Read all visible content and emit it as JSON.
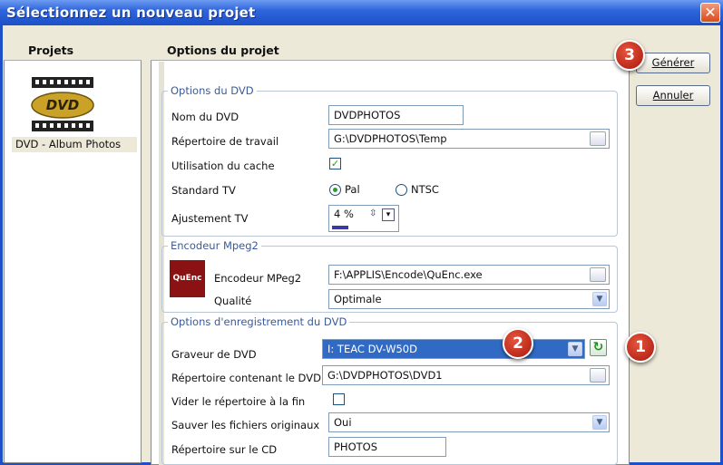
{
  "window": {
    "title": "Sélectionnez un nouveau projet",
    "close_glyph": "✕"
  },
  "projects": {
    "header": "Projets",
    "items": [
      {
        "label": "DVD - Album Photos",
        "icon": "dvd-video-icon"
      }
    ]
  },
  "options": {
    "header": "Options du projet"
  },
  "dvd_group": {
    "title": "Options du DVD",
    "name_label": "Nom du DVD",
    "name_value": "DVDPHOTOS",
    "workdir_label": "Répertoire de travail",
    "workdir_value": "G:\\DVDPHOTOS\\Temp",
    "cache_label": "Utilisation du cache",
    "cache_checked": "✓",
    "tv_label": "Standard TV",
    "tv_pal": "Pal",
    "tv_ntsc": "NTSC",
    "adjust_label": "Ajustement TV",
    "adjust_value": "4 %",
    "adjust_level": 0.25
  },
  "mpeg_group": {
    "title": "Encodeur Mpeg2",
    "logo_text": "QuEnc",
    "encoder_label": "Encodeur MPeg2",
    "encoder_value": "F:\\APPLIS\\Encode\\QuEnc.exe",
    "quality_label": "Qualité",
    "quality_value": "Optimale"
  },
  "record_group": {
    "title": "Options d'enregistrement du DVD",
    "burner_label": "Graveur de DVD",
    "burner_value": "I: TEAC DV-W50D",
    "outdir_label": "Répertoire contenant le DVD",
    "outdir_value": "G:\\DVDPHOTOS\\DVD1",
    "empty_label": "Vider le répertoire à la fin",
    "save_label": "Sauver les fichiers originaux",
    "save_value": "Oui",
    "cddir_label": "Répertoire sur le CD",
    "cddir_value": "PHOTOS"
  },
  "buttons": {
    "generate": "Générer",
    "cancel": "Annuler"
  },
  "callouts": [
    "1",
    "2",
    "3"
  ],
  "colors": {
    "titlebar": "#1c4fc8",
    "callout": "#c0281a",
    "selection": "#316ac5"
  }
}
